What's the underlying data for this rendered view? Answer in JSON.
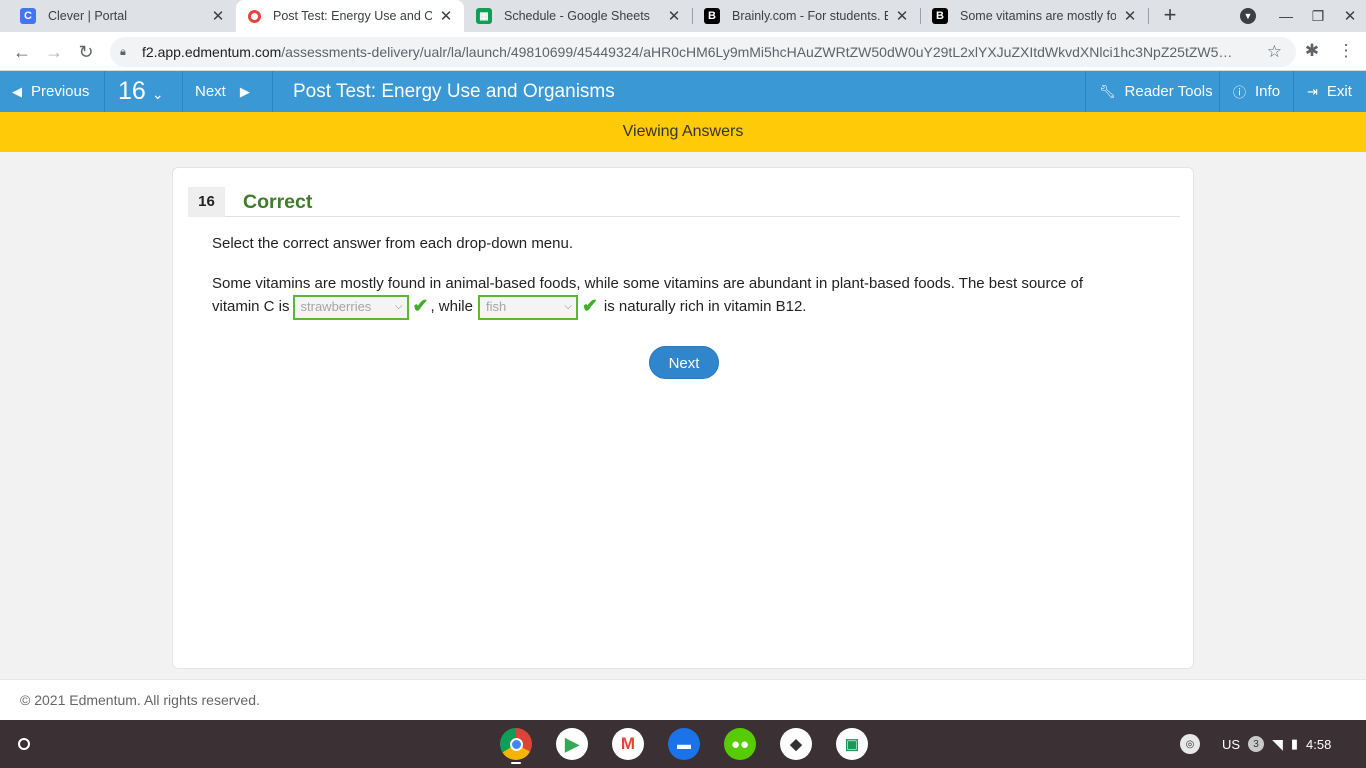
{
  "browser": {
    "tabs": [
      {
        "title": "Clever | Portal",
        "favicon": "clever-logo-icon",
        "color": "#4274f6"
      },
      {
        "title": "Post Test: Energy Use and Org",
        "favicon": "edmentum-logo-icon",
        "color": "#ffffff"
      },
      {
        "title": "Schedule - Google Sheets",
        "favicon": "google-sheets-icon",
        "color": "#0f9d58"
      },
      {
        "title": "Brainly.com - For students. By",
        "favicon": "brainly-logo-icon",
        "color": "#000000"
      },
      {
        "title": "Some vitamins are mostly fou",
        "favicon": "brainly-logo-icon",
        "color": "#000000"
      }
    ],
    "url_host": "f2.app.edmentum.com",
    "url_path": "/assessments-delivery/ualr/la/launch/49810699/45449324/aHR0cHM6Ly9mMi5hcHAuZWRtZW50dW0uY29tL2xlYXJuZXItdWkvdXNlci1hc3NpZ25tZW5…"
  },
  "header": {
    "previous_label": "Previous",
    "question_number": "16",
    "next_label": "Next",
    "test_title": "Post Test: Energy Use and Organisms",
    "reader_tools_label": "Reader Tools",
    "info_label": "Info",
    "exit_label": "Exit"
  },
  "banner": "Viewing Answers",
  "question": {
    "number": "16",
    "status": "Correct",
    "instruction": "Select the correct answer from each drop-down menu.",
    "text_line1": "Some vitamins are mostly found in animal-based foods, while some vitamins are abundant in plant-based foods. The best source of",
    "text_pre": "vitamin C is",
    "answer1": "strawberries",
    "text_mid": ", while",
    "answer2": "fish",
    "text_post": "is naturally rich in vitamin B12.",
    "next_button": "Next"
  },
  "footer": "© 2021 Edmentum. All rights reserved.",
  "shelf": {
    "apps": [
      "chrome-icon",
      "play-store-icon",
      "gmail-icon",
      "files-icon",
      "duolingo-icon",
      "roblox-icon",
      "classroom-icon"
    ],
    "keyboard_layout": "US",
    "notification_count": "3",
    "clock": "4:58"
  },
  "colors": {
    "header_blue": "#3a98d4",
    "banner_yellow": "#ffca08",
    "correct_green": "#3f7c2c",
    "check_green": "#3fae2a"
  }
}
